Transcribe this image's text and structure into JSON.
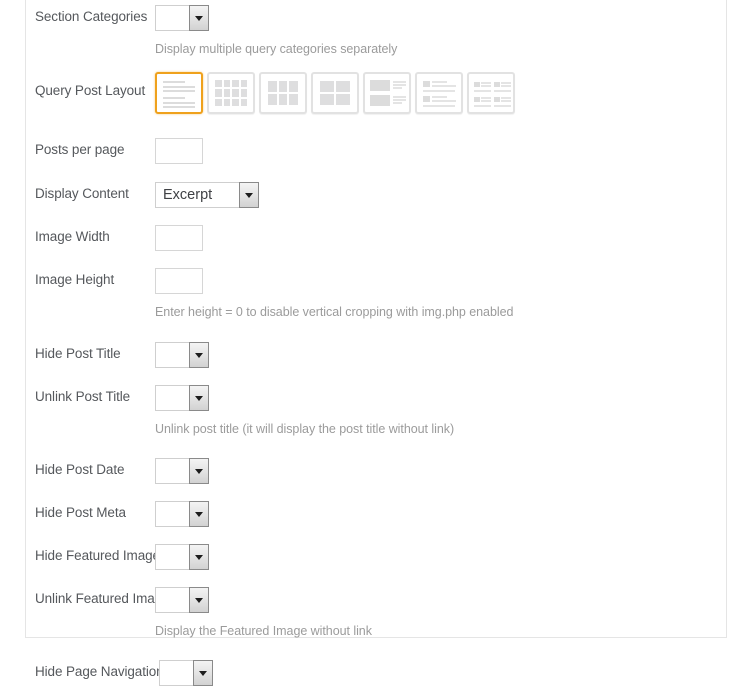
{
  "accent_color": "#efa11c",
  "label_color": "#55585c",
  "hint_color": "#9b9b9b",
  "fields": [
    {
      "id": "section-categories",
      "label": "Section Categories",
      "control": "select",
      "value": "",
      "width": "narrow",
      "hint": "Display multiple query categories separately"
    },
    {
      "id": "query-post-layout",
      "label": "Query Post Layout",
      "control": "layout-picker",
      "selected_index": 0,
      "hint": "",
      "options": [
        {
          "name": "layout-list",
          "icon": "list-rows-icon",
          "selected": true
        },
        {
          "name": "layout-grid-4col",
          "icon": "grid-4col-icon",
          "selected": false
        },
        {
          "name": "layout-grid-3col",
          "icon": "grid-3col-icon",
          "selected": false
        },
        {
          "name": "layout-grid-2col",
          "icon": "grid-2col-icon",
          "selected": false
        },
        {
          "name": "layout-media-large",
          "icon": "media-large-icon",
          "selected": false
        },
        {
          "name": "layout-media-small",
          "icon": "media-small-icon",
          "selected": false
        },
        {
          "name": "layout-media-two-col",
          "icon": "media-two-col-icon",
          "selected": false
        }
      ]
    },
    {
      "id": "posts-per-page",
      "label": "Posts per page",
      "control": "text",
      "value": "",
      "placeholder": "",
      "hint": ""
    },
    {
      "id": "display-content",
      "label": "Display Content",
      "control": "select",
      "value": "Excerpt",
      "width": "wide",
      "hint": ""
    },
    {
      "id": "image-width",
      "label": "Image Width",
      "control": "text",
      "value": "",
      "placeholder": "",
      "hint": ""
    },
    {
      "id": "image-height",
      "label": "Image Height",
      "control": "text",
      "value": "",
      "placeholder": "",
      "hint": "Enter height = 0 to disable vertical cropping with img.php enabled"
    },
    {
      "id": "hide-post-title",
      "label": "Hide Post Title",
      "control": "select",
      "value": "",
      "width": "narrow",
      "hint": ""
    },
    {
      "id": "unlink-post-title",
      "label": "Unlink Post Title",
      "control": "select",
      "value": "",
      "width": "narrow",
      "hint": "Unlink post title (it will display the post title without link)"
    },
    {
      "id": "hide-post-date",
      "label": "Hide Post Date",
      "control": "select",
      "value": "",
      "width": "narrow",
      "hint": ""
    },
    {
      "id": "hide-post-meta",
      "label": "Hide Post Meta",
      "control": "select",
      "value": "",
      "width": "narrow",
      "hint": ""
    },
    {
      "id": "hide-featured-image",
      "label": "Hide Featured Image",
      "control": "select",
      "value": "",
      "width": "narrow",
      "hint": ""
    },
    {
      "id": "unlink-featured-image",
      "label": "Unlink Featured Image",
      "control": "select",
      "value": "",
      "width": "narrow",
      "hint": "Display the Featured Image without link"
    },
    {
      "id": "hide-page-navigation",
      "label": "Hide Page Navigation",
      "control": "select",
      "value": "",
      "width": "narrow",
      "hint": ""
    }
  ]
}
